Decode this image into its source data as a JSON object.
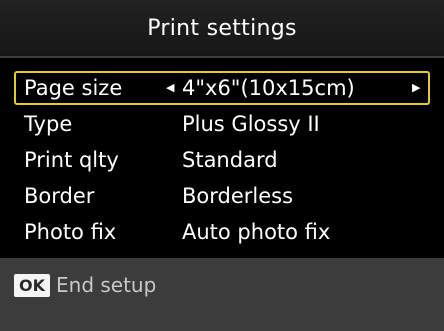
{
  "screen": {
    "title": "Print settings"
  },
  "settings": [
    {
      "label": "Page size",
      "value": "4\"x6\"(10x15cm)",
      "selected": true
    },
    {
      "label": "Type",
      "value": "Plus Glossy II",
      "selected": false
    },
    {
      "label": "Print qlty",
      "value": "Standard",
      "selected": false
    },
    {
      "label": "Border",
      "value": "Borderless",
      "selected": false
    },
    {
      "label": "Photo fix",
      "value": "Auto photo fix",
      "selected": false
    }
  ],
  "footer": {
    "button_icon": "OK",
    "action_label": "End setup"
  },
  "icons": {
    "left_arrow": "triangle-left-icon",
    "right_arrow": "triangle-right-icon"
  },
  "colors": {
    "background": "#000000",
    "selection_border": "#e3cc2c",
    "footer_background": "#3c3c3c"
  }
}
